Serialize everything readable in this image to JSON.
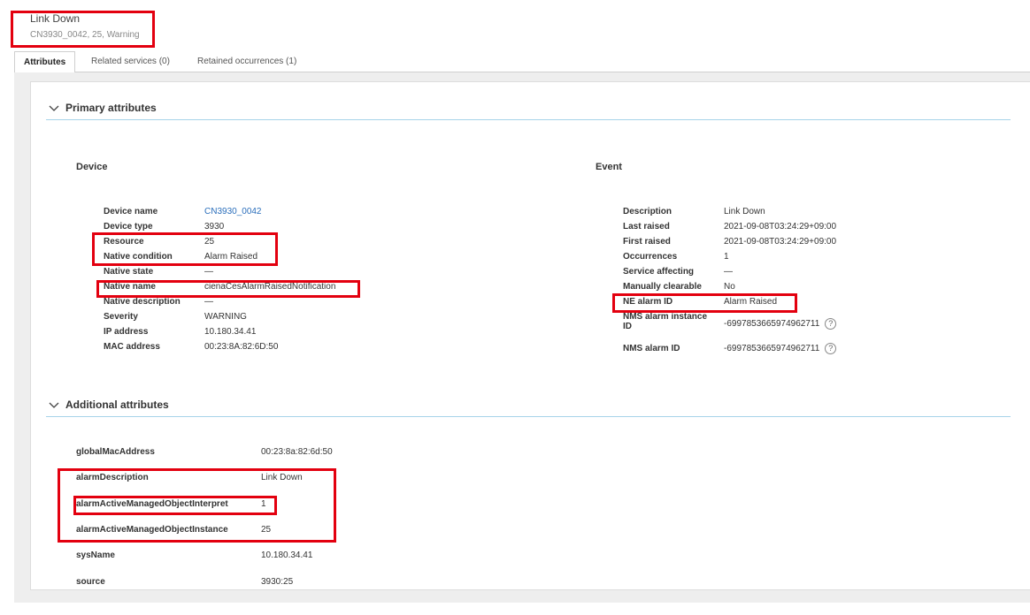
{
  "header": {
    "title": "Link Down",
    "subtitle": "CN3930_0042, 25, Warning"
  },
  "tabs": [
    {
      "label": "Attributes",
      "active": true
    },
    {
      "label": "Related services (0)",
      "active": false
    },
    {
      "label": "Retained occurrences (1)",
      "active": false
    }
  ],
  "primary": {
    "label": "Primary attributes",
    "device": {
      "title": "Device",
      "rows": [
        {
          "k": "Device name",
          "v": "CN3930_0042"
        },
        {
          "k": "Device type",
          "v": "3930"
        },
        {
          "k": "Resource",
          "v": "25"
        },
        {
          "k": "Native condition",
          "v": "Alarm Raised"
        },
        {
          "k": "Native state",
          "v": "—"
        },
        {
          "k": "Native name",
          "v": "cienaCesAlarmRaisedNotification"
        },
        {
          "k": "Native description",
          "v": "—"
        },
        {
          "k": "Severity",
          "v": "WARNING"
        },
        {
          "k": "IP address",
          "v": "10.180.34.41"
        },
        {
          "k": "MAC address",
          "v": "00:23:8A:82:6D:50"
        }
      ]
    },
    "event": {
      "title": "Event",
      "rows": [
        {
          "k": "Description",
          "v": "Link Down"
        },
        {
          "k": "Last raised",
          "v": "2021-09-08T03:24:29+09:00"
        },
        {
          "k": "First raised",
          "v": "2021-09-08T03:24:29+09:00"
        },
        {
          "k": "Occurrences",
          "v": "1"
        },
        {
          "k": "Service affecting",
          "v": "—"
        },
        {
          "k": "Manually clearable",
          "v": "No"
        },
        {
          "k": "NE alarm ID",
          "v": "Alarm Raised"
        },
        {
          "k": "NMS alarm instance ID",
          "v": "-6997853665974962711"
        },
        {
          "k": "NMS alarm ID",
          "v": "-6997853665974962711"
        }
      ],
      "help_glyph": "?"
    }
  },
  "additional": {
    "label": "Additional attributes",
    "rows": [
      {
        "k": "globalMacAddress",
        "v": "00:23:8a:82:6d:50"
      },
      {
        "k": "alarmDescription",
        "v": "Link Down"
      },
      {
        "k": "alarmActiveManagedObjectInterpret",
        "v": "1"
      },
      {
        "k": "alarmActiveManagedObjectInstance",
        "v": "25"
      },
      {
        "k": "sysName",
        "v": "10.180.34.41"
      },
      {
        "k": "source",
        "v": "3930:25"
      }
    ]
  },
  "colors": {
    "highlight": "#e3000f",
    "link": "#2a6ebb",
    "section_rule": "#a7d3e9"
  }
}
